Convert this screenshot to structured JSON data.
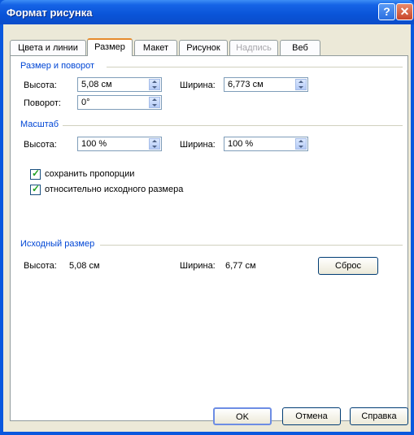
{
  "window": {
    "title": "Формат рисунка",
    "help_glyph": "?",
    "close_glyph": "✕"
  },
  "tabs": [
    {
      "label": "Цвета и линии"
    },
    {
      "label": "Размер",
      "active": true
    },
    {
      "label": "Макет"
    },
    {
      "label": "Рисунок"
    },
    {
      "label": "Надпись",
      "disabled": true
    },
    {
      "label": "Веб"
    }
  ],
  "size_rotate": {
    "title": "Размер и поворот",
    "height_label": "Высота:",
    "height_value": "5,08 см",
    "width_label": "Ширина:",
    "width_value": "6,773 см",
    "rotate_label": "Поворот:",
    "rotate_value": "0°"
  },
  "scale": {
    "title": "Масштаб",
    "height_label": "Высота:",
    "height_value": "100 %",
    "width_label": "Ширина:",
    "width_value": "100 %",
    "keep_ratio_label": "сохранить пропорции",
    "keep_ratio_checked": true,
    "relative_label": "относительно исходного размера",
    "relative_checked": true
  },
  "original": {
    "title": "Исходный размер",
    "height_label": "Высота:",
    "height_value": "5,08 см",
    "width_label": "Ширина:",
    "width_value": "6,77 см",
    "reset_label": "Сброс"
  },
  "footer": {
    "ok_label": "OK",
    "cancel_label": "Отмена",
    "help_label": "Справка"
  }
}
